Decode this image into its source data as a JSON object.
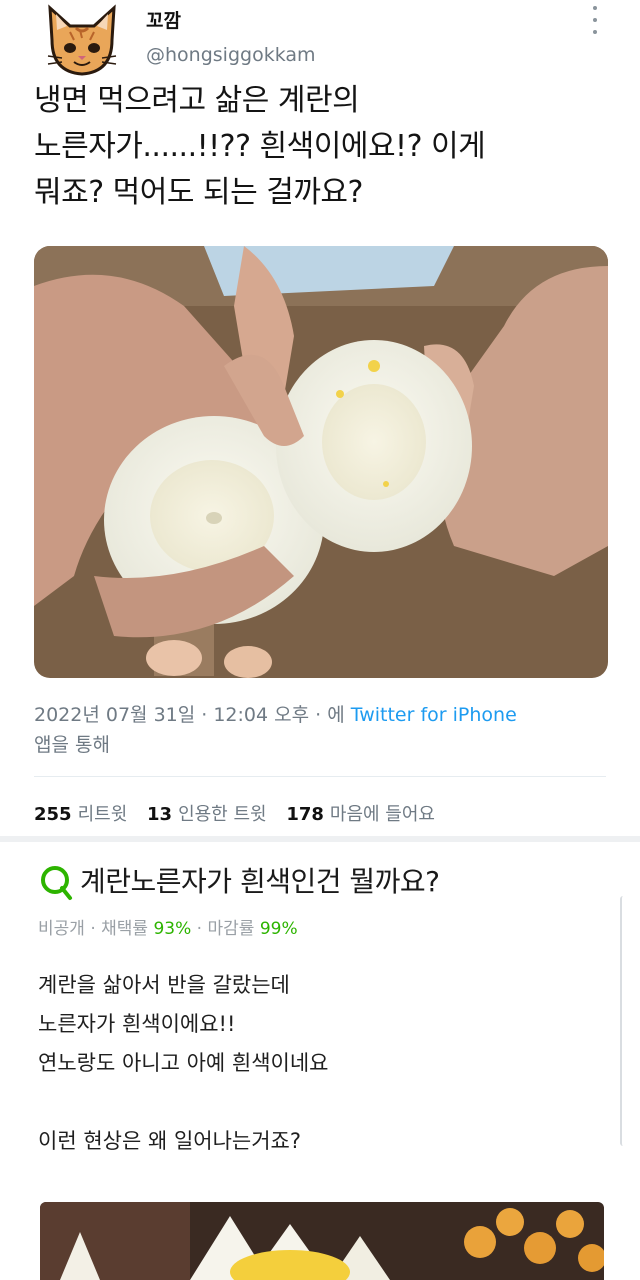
{
  "tweet": {
    "display_name": "꼬깜",
    "handle": "@hongsiggokkam",
    "text_lines": [
      "냉면 먹으려고 삶은 계란의",
      "노른자가......!!?? 흰색이에요!? 이게",
      "뭐죠? 먹어도 되는 걸까요?"
    ],
    "timestamp": "2022년 07월 31일 · 12:04 오후 · 에",
    "source": "Twitter for iPhone",
    "timestamp_tail": "앱을 통해",
    "stats": {
      "retweets_count": "255",
      "retweets_label": "리트윗",
      "quotes_count": "13",
      "quotes_label": "인용한 트윗",
      "likes_count": "178",
      "likes_label": "마음에 들어요"
    }
  },
  "question": {
    "title": "계란노른자가 흰색인건 뭘까요?",
    "meta_prefix": "비공개 · 채택률 ",
    "adopt_rate": "93%",
    "meta_middle": " · 마감률 ",
    "close_rate": "99%",
    "body_lines": [
      "계란을 삶아서 반을 갈랐는데",
      "노른자가 흰색이에요!!",
      "연노랑도 아니고 아예 흰색이네요",
      "",
      "이런 현상은 왜 일어나는거죠?"
    ]
  },
  "colors": {
    "link_blue": "#1d9bf0",
    "naver_green": "#2db400",
    "muted_gray": "#6f7a84"
  },
  "icons": {
    "avatar": "cat-face-icon",
    "more": "more-vertical-icon",
    "question": "q-search-icon"
  }
}
